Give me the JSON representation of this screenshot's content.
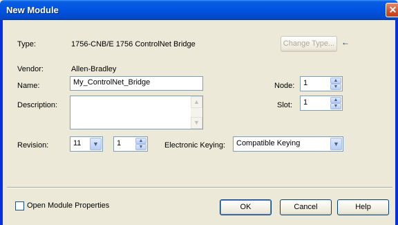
{
  "window": {
    "title": "New Module",
    "close_glyph": "✕"
  },
  "type": {
    "label": "Type:",
    "value": "1756-CNB/E 1756 ControlNet Bridge",
    "change_button": "Change Type...",
    "indicator_glyph": "←"
  },
  "vendor": {
    "label": "Vendor:",
    "value": "Allen-Bradley"
  },
  "name": {
    "label": "Name:",
    "value": "My_ControlNet_Bridge"
  },
  "description": {
    "label": "Description:",
    "value": ""
  },
  "node": {
    "label": "Node:",
    "value": "1"
  },
  "slot": {
    "label": "Slot:",
    "value": "1"
  },
  "revision": {
    "label": "Revision:",
    "major": "11",
    "minor": "1"
  },
  "electronic_keying": {
    "label": "Electronic Keying:",
    "value": "Compatible Keying"
  },
  "footer": {
    "open_module_properties": "Open Module Properties",
    "open_module_properties_checked": false,
    "ok": "OK",
    "cancel": "Cancel",
    "help": "Help"
  },
  "icons": {
    "spin_up": "▲",
    "spin_down": "▼",
    "dropdown": "▼"
  }
}
